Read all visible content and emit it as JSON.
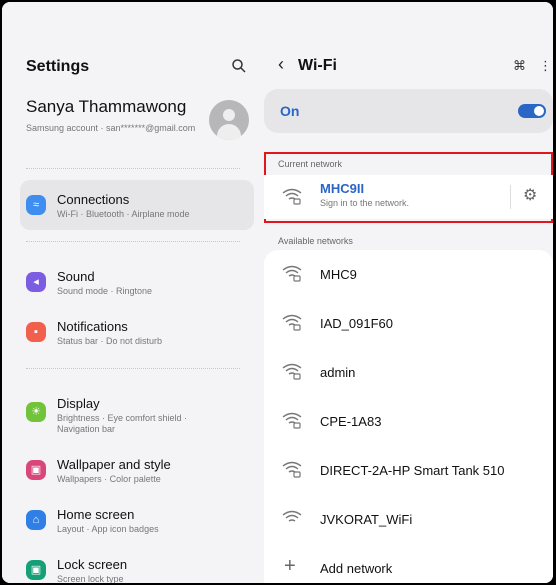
{
  "left": {
    "title": "Settings",
    "profile": {
      "name": "Sanya Thammawong",
      "sub": "Samsung account  ·  san*******@gmail.com"
    },
    "items": [
      {
        "title": "Connections",
        "sub": "Wi-Fi  ·  Bluetooth  ·  Airplane mode",
        "color": "#3d8ef0",
        "glyph": "≈"
      },
      {
        "title": "Sound",
        "sub": "Sound mode  ·  Ringtone",
        "color": "#7c5ce0",
        "glyph": "◂"
      },
      {
        "title": "Notifications",
        "sub": "Status bar  ·  Do not disturb",
        "color": "#f0604c",
        "glyph": "▪"
      },
      {
        "title": "Display",
        "sub": "Brightness  ·  Eye comfort shield  ·  Navigation bar",
        "color": "#71c43a",
        "glyph": "☀"
      },
      {
        "title": "Wallpaper and style",
        "sub": "Wallpapers  ·  Color palette",
        "color": "#d8467a",
        "glyph": "▣"
      },
      {
        "title": "Home screen",
        "sub": "Layout  ·  App icon badges",
        "color": "#2f7fe6",
        "glyph": "⌂"
      },
      {
        "title": "Lock screen",
        "sub": "Screen lock type",
        "color": "#16a077",
        "glyph": "▣"
      }
    ]
  },
  "right": {
    "title": "Wi-Fi",
    "toggle_label": "On",
    "current_label": "Current network",
    "current": {
      "name": "MHC9II",
      "sub": "Sign in to the network."
    },
    "available_label": "Available networks",
    "networks": [
      "MHC9",
      "IAD_091F60",
      "admin",
      "CPE-1A83",
      "DIRECT-2A-HP Smart Tank 510",
      "JVKORAT_WiFi"
    ],
    "add_network": "Add network"
  },
  "colors": {
    "accent": "#2a66c6",
    "highlight": "#e2141c"
  }
}
